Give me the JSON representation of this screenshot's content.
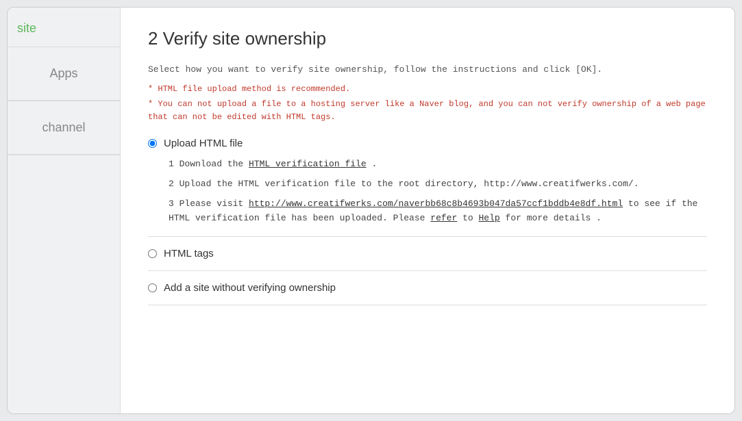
{
  "sidebar": {
    "site_label": "site",
    "items": [
      {
        "id": "apps",
        "label": "Apps"
      },
      {
        "id": "channel",
        "label": "channel"
      }
    ]
  },
  "main": {
    "title": "2 Verify site ownership",
    "description": "Select how you want to verify site ownership, follow the instructions and click [OK].",
    "note_recommended": "* HTML file upload method is recommended.",
    "note_warning": "* You can not upload a file to a hosting server like a Naver blog, and you can not verify ownership of a web page that can not be edited with HTML tags.",
    "options": [
      {
        "id": "upload-html",
        "label": "Upload HTML file",
        "selected": true,
        "steps": [
          {
            "text": "1 Download the ",
            "link_text": "HTML verification file",
            "text_after": " ."
          },
          {
            "text": "2 Upload the HTML verification file to the root directory, http://www.creatifwerks.com/."
          },
          {
            "text": "3 Please visit ",
            "link_text": "http://www.creatifwerks.com/naverbb68c8b4693b047da57ccf1bddb4e8df.html",
            "text_after": " to see if the HTML verification file has been uploaded. Please ",
            "link2_text": "refer",
            "text_after2": " to ",
            "link3_text": "Help",
            "text_after3": " for more details ."
          }
        ]
      },
      {
        "id": "html-tags",
        "label": "HTML tags",
        "selected": false
      },
      {
        "id": "add-without",
        "label": "Add a site without verifying ownership",
        "selected": false
      }
    ]
  }
}
